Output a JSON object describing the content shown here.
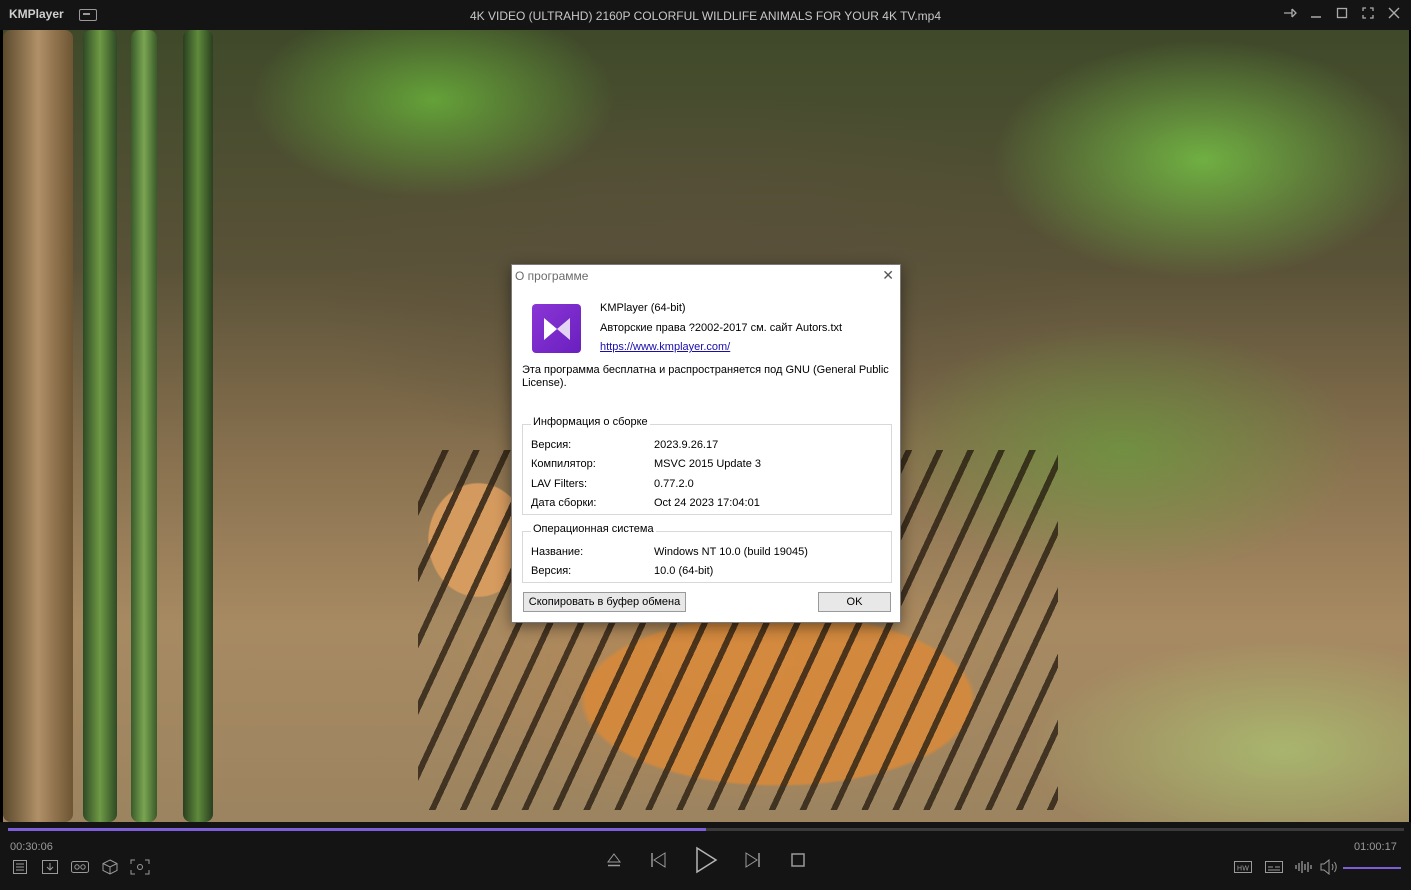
{
  "titlebar": {
    "app_name": "KMPlayer",
    "file_title": "4K VIDEO (ULTRAHD) 2160P COLORFUL WILDLIFE ANIMALS FOR YOUR 4K TV.mp4"
  },
  "dialog": {
    "title": "О программе",
    "product": "KMPlayer (64-bit)",
    "copyright": "Авторские права ?2002-2017 см. сайт Autors.txt",
    "url": "https://www.kmplayer.com/",
    "license_line1": "Эта программа бесплатна и распространяется под GNU (General Public",
    "license_line2": "License).",
    "build_group": {
      "label": "Информация о сборке",
      "rows": [
        {
          "key": "Версия:",
          "value": "2023.9.26.17"
        },
        {
          "key": "Компилятор:",
          "value": "MSVC 2015 Update 3"
        },
        {
          "key": "LAV Filters:",
          "value": "0.77.2.0"
        },
        {
          "key": "Дата сборки:",
          "value": "Oct 24 2023 17:04:01"
        }
      ]
    },
    "os_group": {
      "label": "Операционная система",
      "rows": [
        {
          "key": "Название:",
          "value": "Windows NT 10.0 (build 19045)"
        },
        {
          "key": "Версия:",
          "value": "10.0 (64-bit)"
        }
      ]
    },
    "copy_button": "Скопировать в буфер обмена",
    "ok_button": "OK"
  },
  "player": {
    "elapsed": "00:30:06",
    "duration": "01:00:17",
    "progress": 0.5,
    "volume": 1.0,
    "accent_color": "#7c5ed8"
  },
  "icons": {
    "playlist": "playlist-icon",
    "download": "download-icon",
    "vr": "vr-icon",
    "3d": "3d-icon",
    "capture": "capture-icon",
    "eject": "eject-icon",
    "prev": "previous-icon",
    "play": "play-icon",
    "next": "next-icon",
    "stop": "stop-icon",
    "hw": "hw-decoder-icon",
    "subtitle": "subtitle-icon",
    "equalizer": "equalizer-icon",
    "volume": "volume-icon"
  }
}
